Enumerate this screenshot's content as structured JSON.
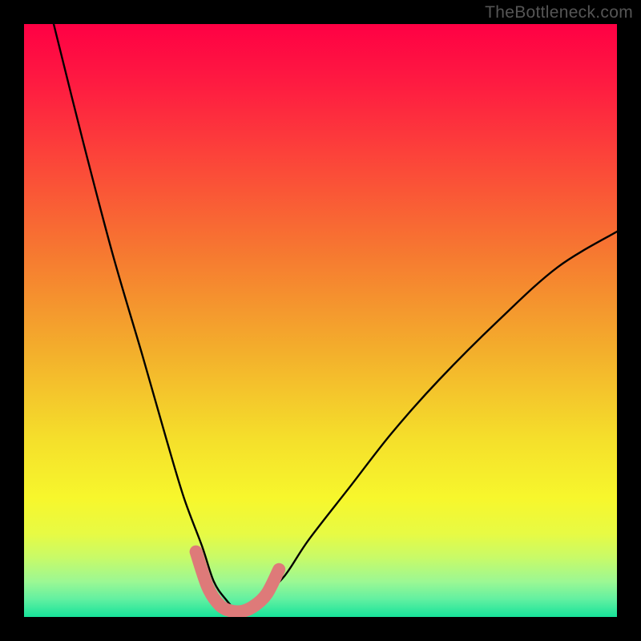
{
  "watermark": "TheBottleneck.com",
  "chart_data": {
    "type": "line",
    "title": "",
    "xlabel": "",
    "ylabel": "",
    "xlim": [
      0,
      100
    ],
    "ylim": [
      0,
      100
    ],
    "series": [
      {
        "name": "bottleneck-curve",
        "x": [
          5,
          10,
          15,
          20,
          24,
          27,
          30,
          32,
          34,
          36,
          38,
          40,
          44,
          48,
          55,
          62,
          70,
          80,
          90,
          100
        ],
        "values": [
          100,
          80,
          61,
          44,
          30,
          20,
          12,
          6,
          3,
          1,
          1,
          3,
          7,
          13,
          22,
          31,
          40,
          50,
          59,
          65
        ]
      },
      {
        "name": "highlight-segment",
        "x": [
          29,
          31,
          33,
          35,
          37,
          39,
          41,
          43
        ],
        "values": [
          11,
          5,
          2,
          1,
          1,
          2,
          4,
          8
        ]
      }
    ],
    "color_bands": [
      {
        "y": 100,
        "color": "#FF0040"
      },
      {
        "y": 85,
        "color": "#FD2F3A"
      },
      {
        "y": 70,
        "color": "#F95F34"
      },
      {
        "y": 55,
        "color": "#F38E2E"
      },
      {
        "y": 40,
        "color": "#F2C72A"
      },
      {
        "y": 25,
        "color": "#F7F72C"
      },
      {
        "y": 15,
        "color": "#D1F85D"
      },
      {
        "y": 8,
        "color": "#A9F98A"
      },
      {
        "y": 3,
        "color": "#5FEE9C"
      },
      {
        "y": 0,
        "color": "#17E39A"
      }
    ]
  }
}
